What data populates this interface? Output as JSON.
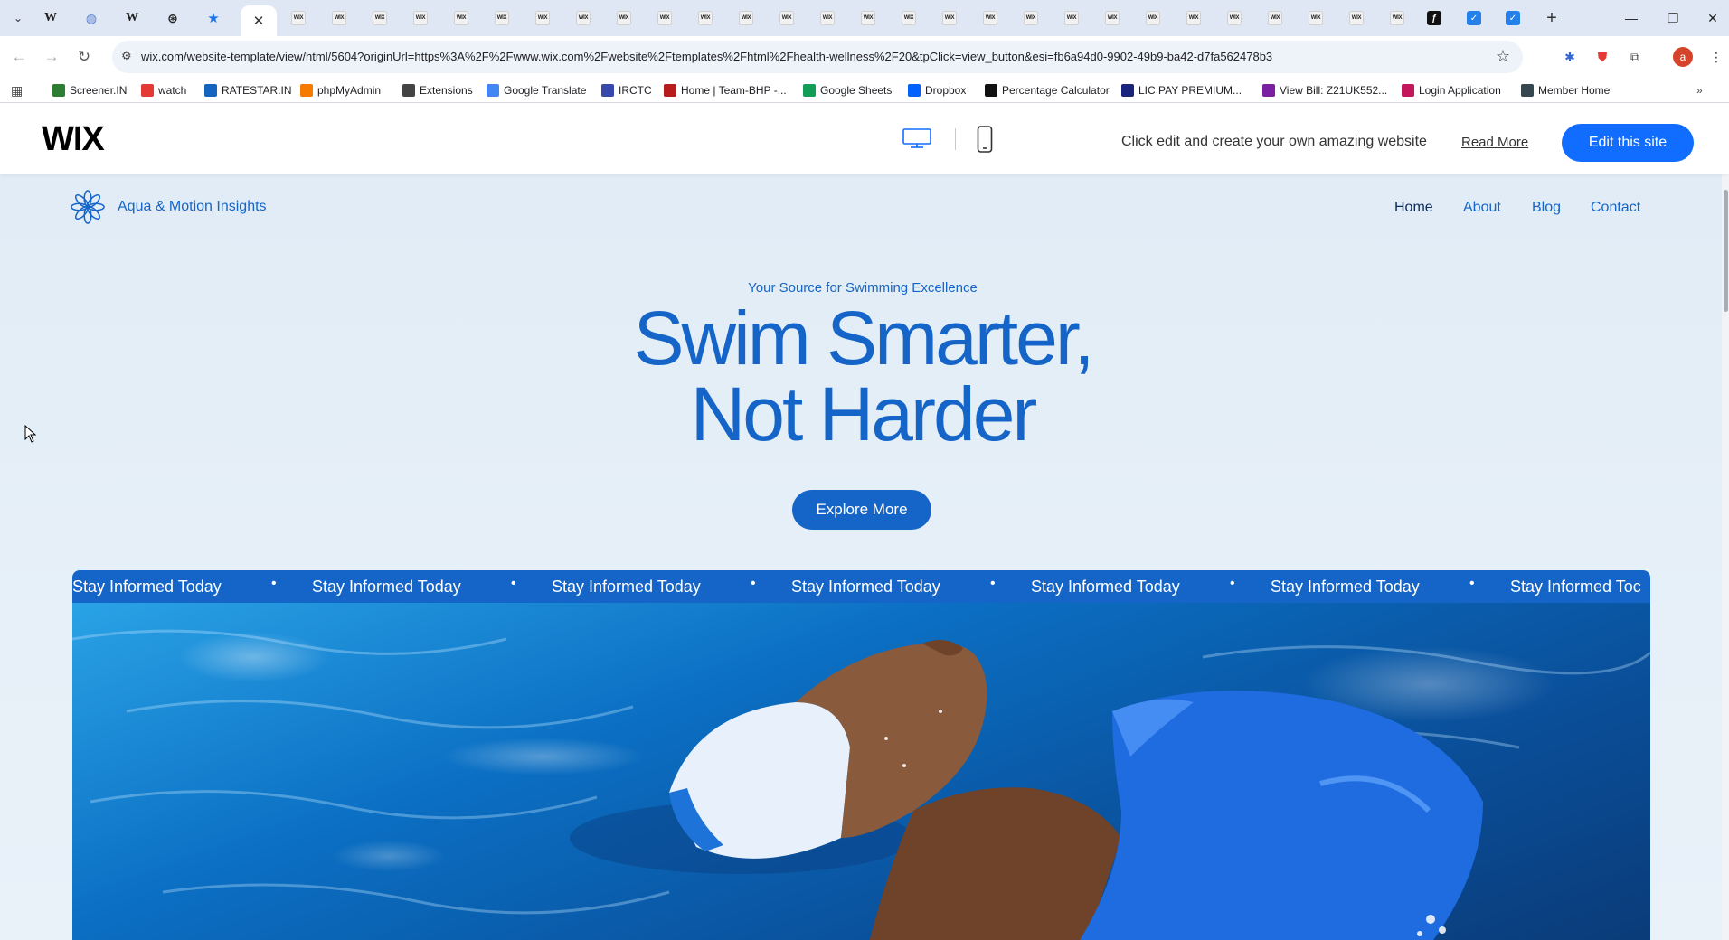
{
  "browser": {
    "tab_icons": [
      "wikipedia",
      "globe",
      "wikipedia",
      "chatgpt",
      "bookmark-star"
    ],
    "active_tab_close": "✕",
    "wix_tab_label": "WIX",
    "new_tab": "+",
    "window_controls": {
      "minimize": "—",
      "restore": "❐",
      "close": "✕"
    },
    "url": "wix.com/website-template/view/html/5604?originUrl=https%3A%2F%2Fwww.wix.com%2Fwebsite%2Ftemplates%2Fhtml%2Fhealth-wellness%2F20&tpClick=view_button&esi=fb6a94d0-9902-49b9-ba42-d7fa562478b3",
    "profile_initial": "a",
    "bookmarks": [
      {
        "label": "Screener.IN",
        "icon_color": "#2e7d32"
      },
      {
        "label": "watch",
        "icon_color": "#e53935"
      },
      {
        "label": "RATESTAR.IN",
        "icon_color": "#1565c0"
      },
      {
        "label": "phpMyAdmin",
        "icon_color": "#f57c00"
      },
      {
        "label": "Extensions",
        "icon_color": "#444444"
      },
      {
        "label": "Google Translate",
        "icon_color": "#4285f4"
      },
      {
        "label": "IRCTC",
        "icon_color": "#3949ab"
      },
      {
        "label": "Home | Team-BHP -...",
        "icon_color": "#b71c1c"
      },
      {
        "label": "Google Sheets",
        "icon_color": "#0f9d58"
      },
      {
        "label": "Dropbox",
        "icon_color": "#0061fe"
      },
      {
        "label": "Percentage Calculator",
        "icon_color": "#111111"
      },
      {
        "label": "LIC PAY PREMIUM...",
        "icon_color": "#1a237e"
      },
      {
        "label": "View Bill: Z21UK552...",
        "icon_color": "#7b1fa2"
      },
      {
        "label": "Login Application",
        "icon_color": "#c2185b"
      },
      {
        "label": "Member Home",
        "icon_color": "#37474f"
      }
    ]
  },
  "wix_bar": {
    "logo": "WIX",
    "promo_text": "Click edit and create your own amazing website",
    "read_more": "Read More",
    "edit_button": "Edit this site"
  },
  "site": {
    "brand_name": "Aqua & Motion Insights",
    "nav": [
      "Home",
      "About",
      "Blog",
      "Contact"
    ],
    "kicker": "Your Source for Swimming Excellence",
    "headline_line1": "Swim Smarter,",
    "headline_line2": "Not Harder",
    "cta": "Explore More",
    "marquee_text": "Stay Informed Today",
    "marquee_last": "Stay Informed Toc",
    "marquee_separator": "•",
    "colors": {
      "accent": "#1565c8",
      "wix_blue": "#116dff"
    }
  }
}
